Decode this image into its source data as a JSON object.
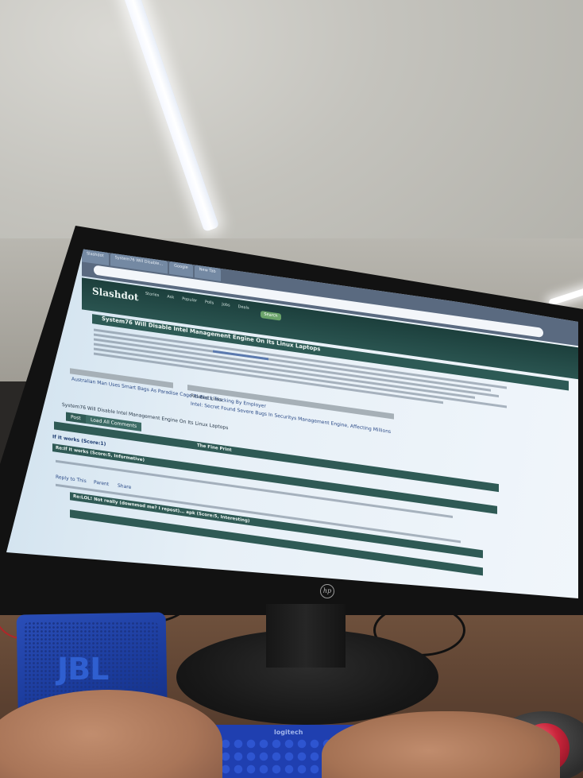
{
  "scene": {
    "colors": {
      "ceiling": "#c4c3bd",
      "desk": "#5e4332",
      "monitor_bezel": "#121212",
      "screen": "#e7f0f7",
      "site_green": "#2f5a55",
      "speaker_blue": "#1a3a9a",
      "keyboard_blue": "#1f3fb0",
      "trackball_red": "#c8243a"
    }
  },
  "browser": {
    "tabs": [
      "Slashdot",
      "System76 Will Disable...",
      "Google",
      "New Tab"
    ]
  },
  "site": {
    "logo": "Slashdot",
    "nav": [
      "Stories",
      "Ask",
      "Popular",
      "Polls",
      "Jobs",
      "Deals"
    ],
    "search_label": "Search"
  },
  "article": {
    "headline": "System76 Will Disable Intel Management Engine On Its Linux Laptops",
    "related_title": "Related Links",
    "related_link": "Intel: Secret Found Severe Bugs In Securitys Management Engine, Affecting Millions",
    "side_link": "Australian Man Uses Smart Bags As Paradise Cage To Block Tracking By Employer",
    "footer_title": "System76 Will Disable Intel Management Engine On Its Linux Laptops"
  },
  "comments": {
    "post_button": "Post",
    "load_all_button": "Load All Comments",
    "filter_label": "The Fine Print",
    "c1_title": "If it works (Score:1)",
    "c2_title": "Re:If it works (Score:5, Informative)",
    "c3_title": "Re:LOL! Not really (downmod me? I repost)... apk (Score:5, Interesting)",
    "reply_link": "Reply to This",
    "parent_link": "Parent",
    "share_link": "Share"
  },
  "keyboard": {
    "brand": "logitech"
  },
  "speaker": {
    "brand": "JBL"
  },
  "monitor": {
    "brand": "hp"
  }
}
